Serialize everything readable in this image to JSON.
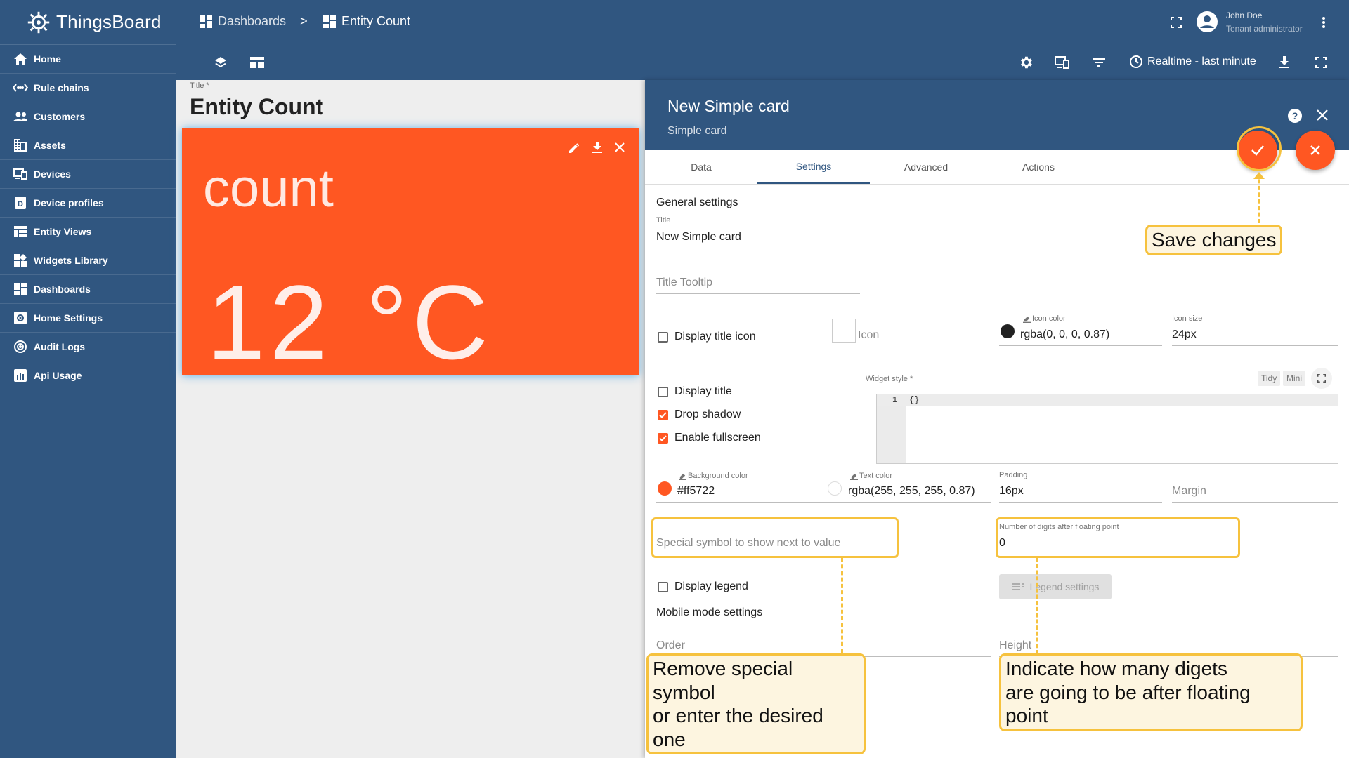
{
  "app": {
    "name": "ThingsBoard"
  },
  "sidebar": {
    "items": [
      {
        "label": "Home",
        "icon": "home-icon"
      },
      {
        "label": "Rule chains",
        "icon": "rule-chains-icon"
      },
      {
        "label": "Customers",
        "icon": "customers-icon"
      },
      {
        "label": "Assets",
        "icon": "assets-icon"
      },
      {
        "label": "Devices",
        "icon": "devices-icon"
      },
      {
        "label": "Device profiles",
        "icon": "device-profiles-icon"
      },
      {
        "label": "Entity Views",
        "icon": "entity-views-icon"
      },
      {
        "label": "Widgets Library",
        "icon": "widgets-library-icon"
      },
      {
        "label": "Dashboards",
        "icon": "dashboards-icon"
      },
      {
        "label": "Home Settings",
        "icon": "home-settings-icon"
      },
      {
        "label": "Audit Logs",
        "icon": "audit-logs-icon"
      },
      {
        "label": "Api Usage",
        "icon": "api-usage-icon"
      }
    ]
  },
  "header": {
    "breadcrumb": [
      "Dashboards",
      "Entity Count"
    ],
    "separator": ">",
    "user": {
      "name": "John Doe",
      "role": "Tenant administrator"
    },
    "timewindow": "Realtime - last minute"
  },
  "dashboard": {
    "title_label": "Title *",
    "title": "Entity Count",
    "widget": {
      "label": "count",
      "value": "12 °C",
      "background": "#ff5722"
    }
  },
  "panel": {
    "title": "New Simple card",
    "subtitle": "Simple card",
    "tabs": [
      "Data",
      "Settings",
      "Advanced",
      "Actions"
    ],
    "active_tab": "Settings",
    "general_settings": "General settings",
    "title_field": {
      "label": "Title",
      "value": "New Simple card"
    },
    "title_tooltip": {
      "placeholder": "Title Tooltip"
    },
    "display_title_icon": {
      "label": "Display title icon",
      "checked": false
    },
    "icon": {
      "placeholder": "Icon"
    },
    "icon_color": {
      "label": "Icon color",
      "value": "rgba(0, 0, 0, 0.87)"
    },
    "icon_size": {
      "label": "Icon size",
      "value": "24px"
    },
    "display_title": {
      "label": "Display title",
      "checked": false
    },
    "drop_shadow": {
      "label": "Drop shadow",
      "checked": true
    },
    "enable_fullscreen": {
      "label": "Enable fullscreen",
      "checked": true
    },
    "widget_style": {
      "label": "Widget style *",
      "tidy": "Tidy",
      "mini": "Mini",
      "line_number": "1",
      "code": "{}"
    },
    "background_color": {
      "label": "Background color",
      "value": "#ff5722"
    },
    "text_color": {
      "label": "Text color",
      "value": "rgba(255, 255, 255, 0.87)"
    },
    "padding": {
      "label": "Padding",
      "value": "16px"
    },
    "margin": {
      "placeholder": "Margin"
    },
    "special_symbol": {
      "placeholder": "Special symbol to show next to value"
    },
    "decimals": {
      "label": "Number of digits after floating point",
      "value": "0"
    },
    "display_legend": {
      "label": "Display legend",
      "checked": false
    },
    "legend_settings": "Legend settings",
    "mobile_mode": "Mobile mode settings",
    "order": {
      "placeholder": "Order"
    },
    "height": {
      "placeholder": "Height"
    }
  },
  "callouts": {
    "save": "Save changes",
    "symbol": [
      "Remove special symbol",
      "or enter the desired one"
    ],
    "digits": [
      "Indicate how many digets",
      "are going to be after floating point"
    ]
  },
  "colors": {
    "primary": "#305680",
    "accent": "#ff5722",
    "callout_border": "#f6c23e",
    "callout_fill": "#fdf5e0"
  }
}
